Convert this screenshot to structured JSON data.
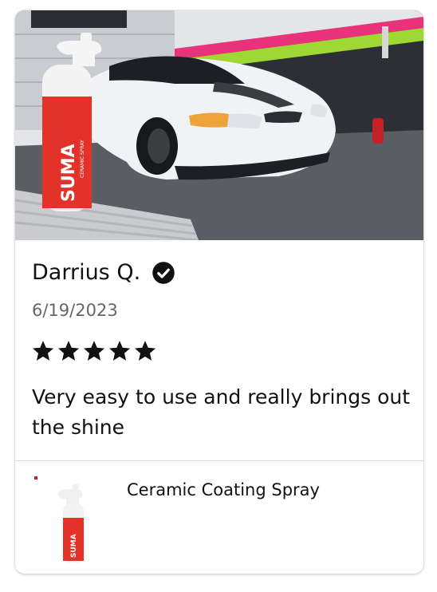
{
  "review": {
    "reviewer_name": "Darrius Q.",
    "verified_icon": "check-circle-icon",
    "date": "6/19/2023",
    "rating": 5,
    "rating_max": 5,
    "body": "Very easy to use and really brings out the shine",
    "photo_label": "SUMA",
    "photo_sublabel": "CERAMIC SPRAY"
  },
  "product": {
    "name": "Ceramic Coating Spray",
    "thumb_label": "SUMA"
  },
  "colors": {
    "star": "#111111",
    "brand_red": "#e3322a",
    "car_white": "#f1f2f3",
    "wall_pink": "#e8337a",
    "wall_green": "#9fd834"
  }
}
